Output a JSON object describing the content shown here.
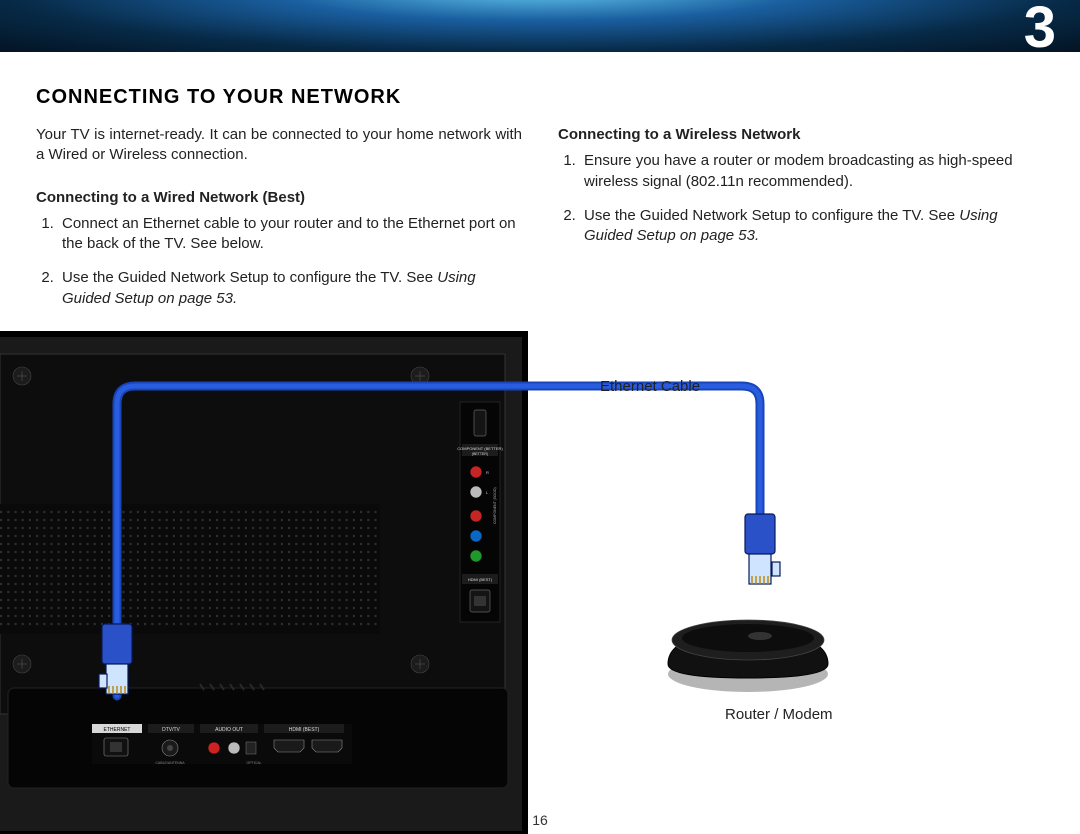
{
  "chapter_number": "3",
  "page_number": "16",
  "main_heading": "CONNECTING TO YOUR NETWORK",
  "intro_text": "Your TV is internet-ready. It can be connected to your home network with a Wired or Wireless connection.",
  "left": {
    "subheading": "Connecting to a Wired Network (Best)",
    "step1": "Connect an Ethernet cable to your router and to the Ethernet port on the back of the TV. See below.",
    "step2_a": "Use the Guided Network Setup to configure the TV. See ",
    "step2_b": "Using Guided Setup on page 53.",
    "step2_b_plain": ""
  },
  "right": {
    "subheading": "Connecting to a Wireless Network",
    "step1": "Ensure you have a router or modem broadcasting as high-speed wireless signal (802.11n recommended).",
    "step2_a": "Use the Guided Network Setup to configure the TV. See ",
    "step2_b": "Using Guided Setup on page 53.",
    "step2_b_plain": ""
  },
  "diagram": {
    "ethernet_cable_label": "Ethernet Cable",
    "router_label": "Router / Modem",
    "tv_ports": {
      "component_label": "COMPONENT (BETTER)",
      "hdmi_label": "HDMI (BEST)",
      "ethernet_label": "ETHERNET",
      "dtv_label": "DTV/TV",
      "audio_out_label": "AUDIO OUT",
      "hdmi_best_label": "HDMI (BEST)"
    }
  }
}
